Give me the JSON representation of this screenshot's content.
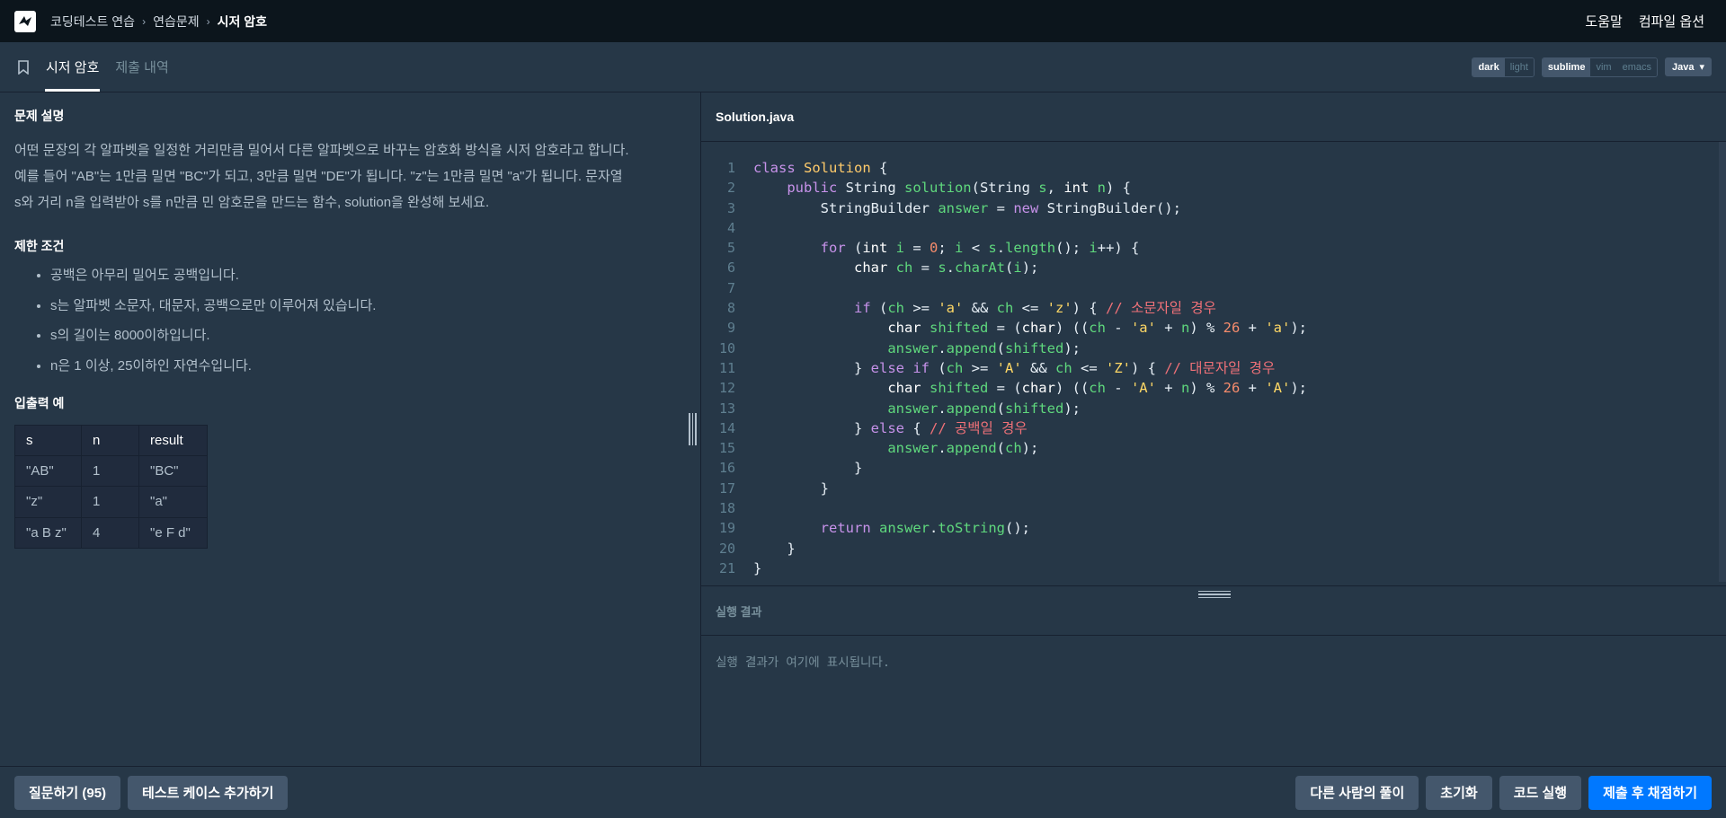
{
  "topbar": {
    "breadcrumb": [
      "코딩테스트 연습",
      "연습문제",
      "시저 암호"
    ],
    "help": "도움말",
    "compile_options": "컴파일 옵션"
  },
  "tabs": {
    "problem": "시저 암호",
    "submissions": "제출 내역"
  },
  "toolbar": {
    "theme": [
      "dark",
      "light"
    ],
    "theme_selected": "dark",
    "keymap": [
      "sublime",
      "vim",
      "emacs"
    ],
    "keymap_selected": "sublime",
    "language": "Java"
  },
  "problem": {
    "desc_title": "문제 설명",
    "desc_lines": [
      "어떤 문장의 각 알파벳을 일정한 거리만큼 밀어서 다른 알파벳으로 바꾸는 암호화 방식을 시저 암호라고 합니다.",
      "예를 들어 \"AB\"는 1만큼 밀면 \"BC\"가 되고, 3만큼 밀면 \"DE\"가 됩니다. \"z\"는 1만큼 밀면 \"a\"가 됩니다. 문자열",
      "s와 거리 n을 입력받아 s를 n만큼 민 암호문을 만드는 함수, solution을 완성해 보세요."
    ],
    "limits_title": "제한 조건",
    "limits": [
      "공백은 아무리 밀어도 공백입니다.",
      "s는 알파벳 소문자, 대문자, 공백으로만 이루어져 있습니다.",
      "s의 길이는 8000이하입니다.",
      "n은 1 이상, 25이하인 자연수입니다."
    ],
    "examples_title": "입출력 예",
    "table": {
      "headers": [
        "s",
        "n",
        "result"
      ],
      "rows": [
        [
          "\"AB\"",
          "1",
          "\"BC\""
        ],
        [
          "\"z\"",
          "1",
          "\"a\""
        ],
        [
          "\"a B z\"",
          "4",
          "\"e F d\""
        ]
      ]
    }
  },
  "editor": {
    "filename": "Solution.java",
    "line_numbers": [
      "1",
      "2",
      "3",
      "4",
      "5",
      "6",
      "7",
      "8",
      "9",
      "10",
      "11",
      "12",
      "13",
      "14",
      "15",
      "16",
      "17",
      "18",
      "19",
      "20",
      "21"
    ]
  },
  "result": {
    "title": "실행 결과",
    "placeholder": "실행 결과가 여기에 표시됩니다."
  },
  "bottom": {
    "ask": "질문하기 (95)",
    "add_testcase": "테스트 케이스 추가하기",
    "others": "다른 사람의 풀이",
    "reset": "초기화",
    "run": "코드 실행",
    "submit": "제출 후 채점하기"
  }
}
